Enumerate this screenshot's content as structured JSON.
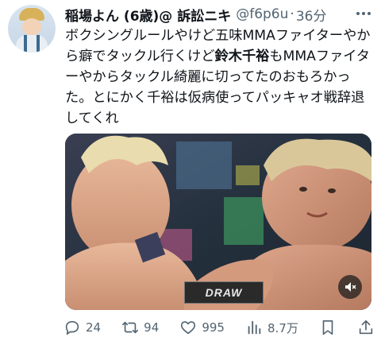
{
  "author": {
    "display_name": "稲場よん (6歳)@ 訴訟ニキ",
    "handle": "@f6p6u",
    "separator": "·",
    "time": "36分"
  },
  "tweet": {
    "part1": "ボクシングルールやけど五味MMAファイターやから癖でタックル行くけど",
    "highlight": "鈴木千裕",
    "part2": "もMMAファイターやからタックル綺麗に切ってたのおもろかった。とにかく千裕は仮病使ってパッキャオ戦辞退してくれ"
  },
  "media": {
    "banner_text": "DRAW",
    "mute_icon": "speaker-muted-icon"
  },
  "actions": {
    "replies": "24",
    "retweets": "94",
    "likes": "995",
    "views": "8.7万"
  },
  "colors": {
    "text": "#0f1419",
    "secondary": "#536471",
    "background": "#ffffff"
  }
}
